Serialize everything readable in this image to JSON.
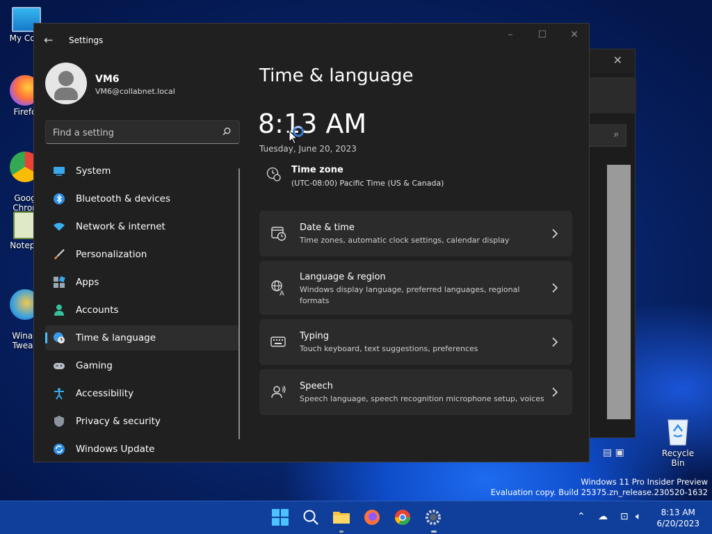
{
  "desktop": {
    "icons": [
      {
        "label": "My Com"
      },
      {
        "label": "Firefo"
      },
      {
        "label": "Goog\nChron"
      },
      {
        "label": "Notepa"
      },
      {
        "label": "Winae\nTweak"
      }
    ],
    "recycle_bin": "Recycle Bin",
    "watermark_line1": "Windows 11 Pro Insider Preview",
    "watermark_line2": "Evaluation copy. Build 25375.zn_release.230520-1632"
  },
  "window": {
    "title": "Settings",
    "minimize_icon": "minimize-icon",
    "maximize_icon": "maximize-icon",
    "close_icon": "close-icon"
  },
  "profile": {
    "name": "VM6",
    "email": "VM6@collabnet.local"
  },
  "search": {
    "placeholder": "Find a setting"
  },
  "nav": {
    "items": [
      {
        "label": "System",
        "icon": "system-icon"
      },
      {
        "label": "Bluetooth & devices",
        "icon": "bluetooth-icon"
      },
      {
        "label": "Network & internet",
        "icon": "wifi-icon"
      },
      {
        "label": "Personalization",
        "icon": "brush-icon"
      },
      {
        "label": "Apps",
        "icon": "apps-icon"
      },
      {
        "label": "Accounts",
        "icon": "person-icon"
      },
      {
        "label": "Time & language",
        "icon": "globe-clock-icon",
        "selected": true
      },
      {
        "label": "Gaming",
        "icon": "gamepad-icon"
      },
      {
        "label": "Accessibility",
        "icon": "accessibility-icon"
      },
      {
        "label": "Privacy & security",
        "icon": "shield-icon"
      },
      {
        "label": "Windows Update",
        "icon": "update-icon"
      }
    ]
  },
  "main": {
    "title": "Time & language",
    "clock": "8:13 AM",
    "date": "Tuesday, June 20, 2023",
    "timezone_label": "Time zone",
    "timezone_value": "(UTC-08:00) Pacific Time (US & Canada)",
    "cards": [
      {
        "title": "Date & time",
        "desc": "Time zones, automatic clock settings, calendar display",
        "icon": "calendar-clock-icon"
      },
      {
        "title": "Language & region",
        "desc": "Windows display language, preferred languages, regional formats",
        "icon": "language-icon"
      },
      {
        "title": "Typing",
        "desc": "Touch keyboard, text suggestions, preferences",
        "icon": "keyboard-icon"
      },
      {
        "title": "Speech",
        "desc": "Speech language, speech recognition microphone setup, voices",
        "icon": "speech-icon"
      }
    ]
  },
  "taskbar": {
    "time": "8:13 AM",
    "date": "6/20/2023"
  },
  "colors": {
    "accent": "#4cc2ff",
    "window_bg": "#202020",
    "card_bg": "#2b2b2b",
    "taskbar_bg": "#0f3f9b"
  }
}
